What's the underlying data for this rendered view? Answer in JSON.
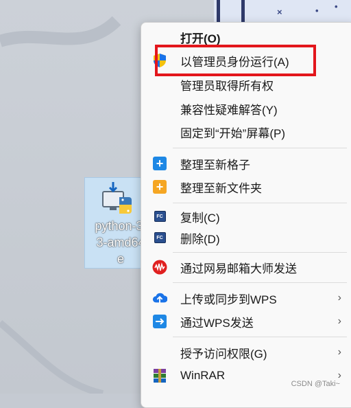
{
  "desktop": {
    "file": {
      "name_lines": "python-3.\n3-amd64\ne"
    }
  },
  "menu": {
    "items": [
      {
        "label": "打开(O)",
        "icon": ""
      },
      {
        "label": "以管理员身份运行(A)",
        "icon": "shield-icon"
      },
      {
        "label": "管理员取得所有权",
        "icon": ""
      },
      {
        "label": "兼容性疑难解答(Y)",
        "icon": ""
      },
      {
        "label": "固定到“开始”屏幕(P)",
        "icon": ""
      },
      {
        "label": "整理至新格子",
        "icon": "plus-tile-icon"
      },
      {
        "label": "整理至新文件夹",
        "icon": "plus-folder-icon"
      },
      {
        "label": "复制(C)",
        "icon": "fc-icon"
      },
      {
        "label": "删除(D)",
        "icon": "fc-icon"
      },
      {
        "label": "通过网易邮箱大师发送",
        "icon": "netease-mail-icon"
      },
      {
        "label": "上传或同步到WPS",
        "icon": "cloud-upload-icon",
        "arrow": "›"
      },
      {
        "label": "通过WPS发送",
        "icon": "send-arrow-icon",
        "arrow": "›"
      },
      {
        "label": "授予访问权限(G)",
        "icon": "",
        "arrow": "›"
      },
      {
        "label": "WinRAR",
        "icon": "winrar-icon",
        "arrow": "›"
      }
    ]
  },
  "fc_icon_text": "FC",
  "watermark": "CSDN @Taki~",
  "colors": {
    "highlight": "#e3161c",
    "tile_blue": "#1e88e5",
    "folder_orange": "#f5a623",
    "netease_red": "#e02020",
    "cloud_blue": "#1a73e8"
  }
}
